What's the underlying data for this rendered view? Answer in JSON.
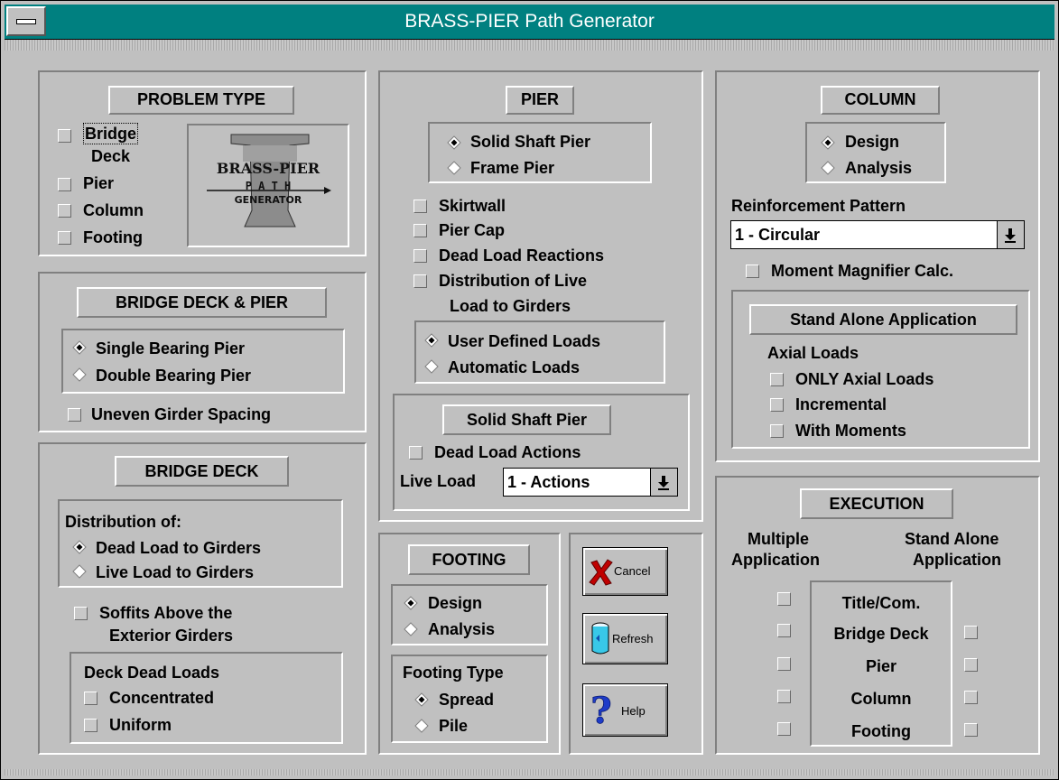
{
  "window": {
    "title": "BRASS-PIER Path Generator"
  },
  "problem_type": {
    "header": "PROBLEM TYPE",
    "bridge_line1": "Bridge",
    "bridge_line2": "Deck",
    "pier": "Pier",
    "column": "Column",
    "footing": "Footing",
    "logo_text_1": "BRASS-PIER",
    "logo_text_2": "P A T H",
    "logo_text_3": "GENERATOR"
  },
  "bridge_deck_pier": {
    "header": "BRIDGE DECK & PIER",
    "single": "Single Bearing Pier",
    "double": "Double Bearing Pier",
    "uneven": "Uneven Girder Spacing"
  },
  "bridge_deck": {
    "header": "BRIDGE DECK",
    "dist_label": "Distribution of:",
    "dead": "Dead Load to Girders",
    "live": "Live Load to Girders",
    "soffits_line1": "Soffits Above the",
    "soffits_line2": "Exterior Girders",
    "deck_dead_loads": "Deck Dead Loads",
    "concentrated": "Concentrated",
    "uniform": "Uniform"
  },
  "pier": {
    "header": "PIER",
    "solid": "Solid Shaft Pier",
    "frame": "Frame Pier",
    "skirtwall": "Skirtwall",
    "pier_cap": "Pier Cap",
    "dead_load_reactions": "Dead Load Reactions",
    "dist_live_line1": "Distribution of Live",
    "dist_live_line2": "Load to Girders",
    "user_defined": "User Defined Loads",
    "automatic": "Automatic Loads",
    "solid_header": "Solid Shaft Pier",
    "dead_load_actions": "Dead Load Actions",
    "live_load_label": "Live Load",
    "live_load_value": "1 - Actions"
  },
  "footing": {
    "header": "FOOTING",
    "design": "Design",
    "analysis": "Analysis",
    "type_label": "Footing Type",
    "spread": "Spread",
    "pile": "Pile"
  },
  "buttons": {
    "cancel": "Cancel",
    "refresh": "Refresh",
    "help": "Help"
  },
  "column": {
    "header": "COLUMN",
    "design": "Design",
    "analysis": "Analysis",
    "reinf_label": "Reinforcement Pattern",
    "reinf_value": "1 - Circular",
    "moment": "Moment Magnifier Calc.",
    "stand_alone_header": "Stand Alone Application",
    "axial_loads": "Axial Loads",
    "only_axial": "ONLY Axial Loads",
    "incremental": "Incremental",
    "with_moments": "With Moments"
  },
  "execution": {
    "header": "EXECUTION",
    "multiple_line1": "Multiple",
    "multiple_line2": "Application",
    "stand_line1": "Stand Alone",
    "stand_line2": "Application",
    "rows": [
      "Title/Com.",
      "Bridge Deck",
      "Pier",
      "Column",
      "Footing"
    ]
  },
  "colors": {
    "titlebar": "#008080",
    "face": "#c0c0c0",
    "cancel_x": "#c00000",
    "help_q": "#1e3cc8"
  }
}
